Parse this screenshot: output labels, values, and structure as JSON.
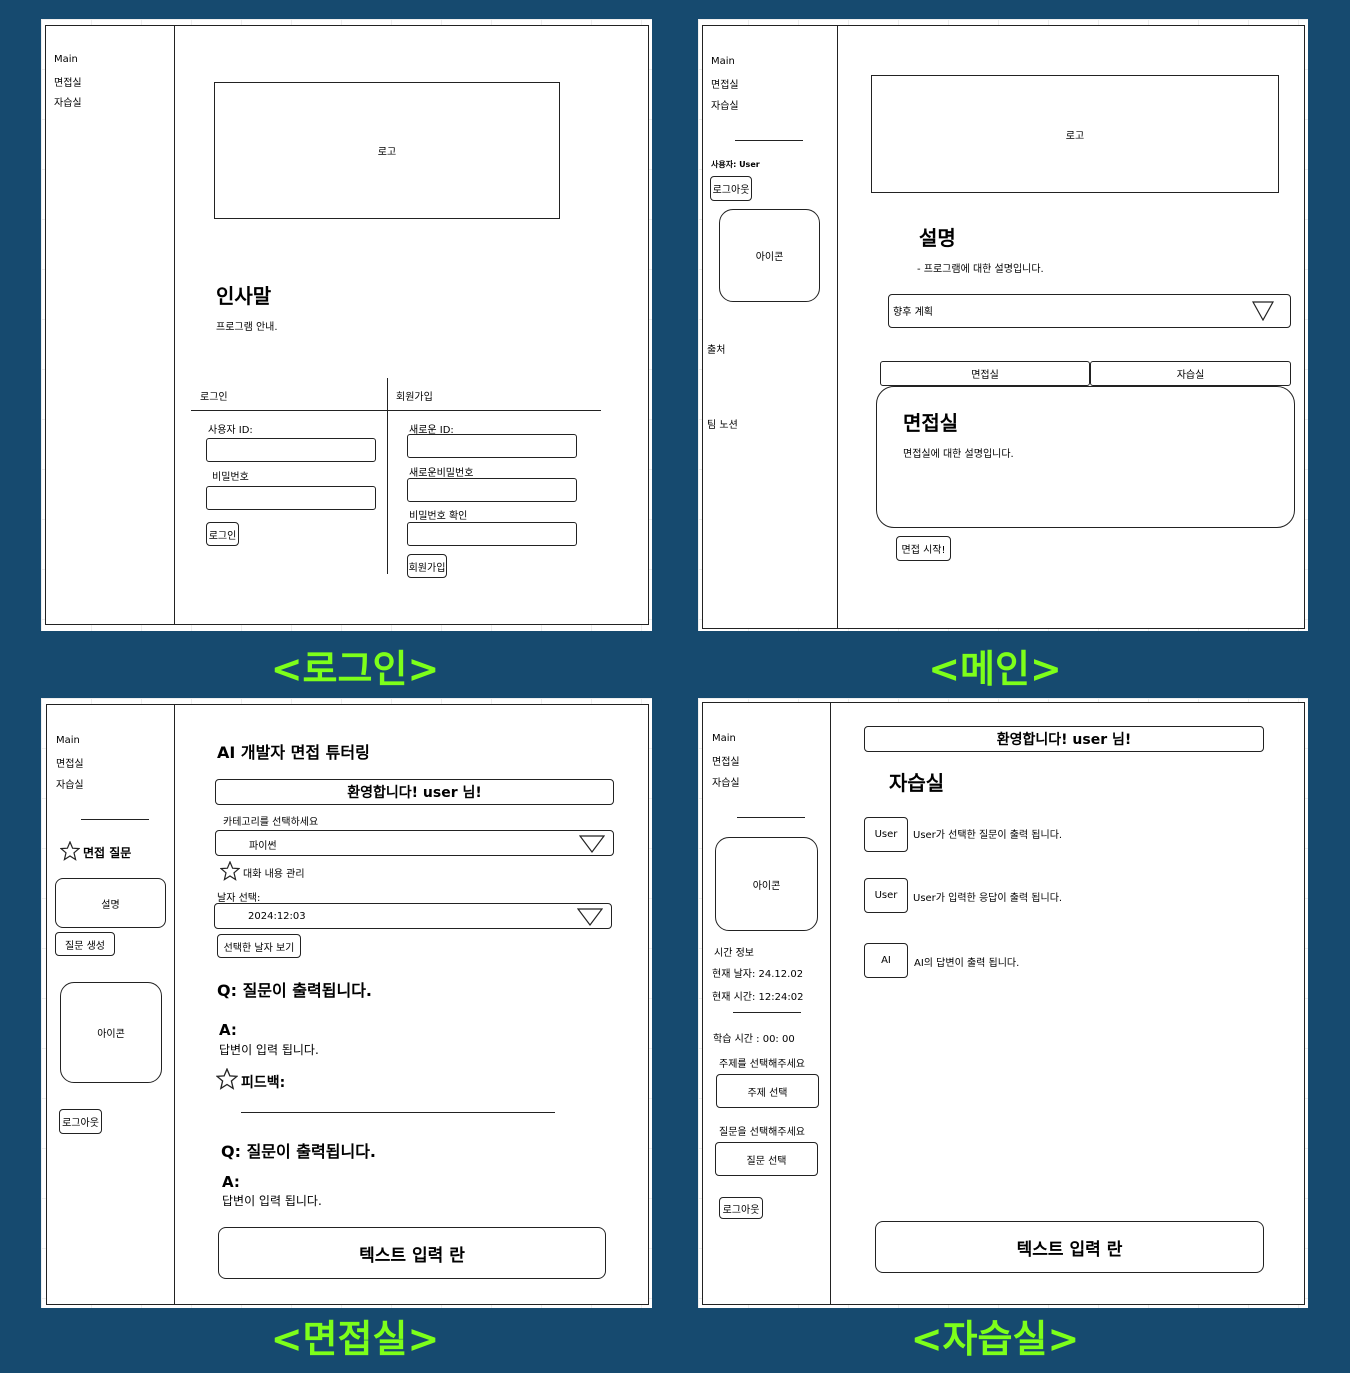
{
  "colors": {
    "background": "#164a6f",
    "caption": "#7dff1a"
  },
  "sidebar_nav": [
    "Main",
    "면접실",
    "자습실"
  ],
  "login": {
    "caption": "<로그인>",
    "logo": "로고",
    "greeting_title": "인사말",
    "greeting_text": "프로그램 안내.",
    "login_tab": "로그인",
    "signup_tab": "회원가입",
    "user_id_label": "사용자 ID:",
    "password_label": "비밀번호",
    "login_button": "로그인",
    "new_id_label": "새로운 ID:",
    "new_password_label": "새로운비밀번호",
    "password_confirm_label": "비밀번호 확인",
    "signup_button": "회원가입"
  },
  "main": {
    "caption": "<메인>",
    "user_label": "사용자: User",
    "logout_button": "로그아웃",
    "icon_label": "아이콘",
    "source_label": "출처",
    "team_notion": "팀 노션",
    "logo": "로고",
    "desc_title": "설명",
    "desc_text": "- 프로그램에 대한 설명입니다.",
    "dropdown_value": "향후 계획",
    "tabs": [
      "면접실",
      "자습실"
    ],
    "card_title": "면접실",
    "card_text": "면접실에 대한 설명입니다.",
    "start_button": "면접 시작!"
  },
  "interview": {
    "caption": "<면접실>",
    "sidebar_question_label": "면접 질문",
    "sidebar_desc_button": "설명",
    "sidebar_generate_button": "질문 생성",
    "icon_label": "아이콘",
    "logout_button": "로그아웃",
    "title": "AI 개발자 면접 튜터링",
    "welcome": "환영합니다!  user 님!",
    "category_label": "카테고리를 선택하세요",
    "category_value": "파이썬",
    "chat_manage_label": "대화 내용 관리",
    "date_label": "날자 선택:",
    "date_value": "2024:12:03",
    "view_date_button": "선택한 날자 보기",
    "q1_label": "Q",
    "q1_text": ": 질문이 출력됩니다.",
    "a1_label": "A:",
    "a1_text": "답변이 입력 됩니다.",
    "feedback_label": "피드백:",
    "q2_label": "Q",
    "q2_text": ": 질문이 출력됩니다.",
    "a2_label": "A:",
    "a2_text": "답변이 입력 됩니다.",
    "text_input": "텍스트 입력 란"
  },
  "study": {
    "caption": "<자습실>",
    "icon_label": "아이콘",
    "time_info_label": "시간 정보",
    "current_date": "현재 날자:  24.12.02",
    "current_time": "현재 시간:  12:24:02",
    "study_time": "학습 시간 : 00: 00",
    "topic_prompt": "주제를 선택해주세요",
    "topic_button": "주제 선택",
    "question_prompt": "질문을 선택해주세요",
    "question_button": "질문 선택",
    "logout_button": "로그아웃",
    "welcome": "환영합니다!  user 님!",
    "title": "자습실",
    "messages": [
      {
        "sender": "User",
        "text": "User가 선택한 질문이 출력 됩니다."
      },
      {
        "sender": "User",
        "text": "User가 입력한 응답이 출력 됩니다."
      },
      {
        "sender": "AI",
        "text": "AI의 답변이 출력 됩니다."
      }
    ],
    "text_input": "텍스트 입력 란"
  }
}
